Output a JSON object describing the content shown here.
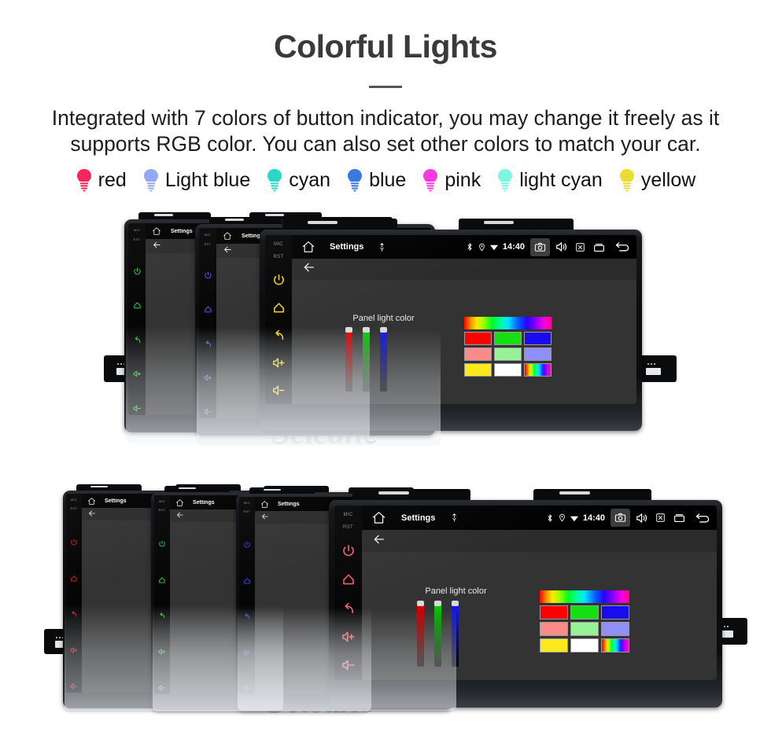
{
  "header": {
    "title": "Colorful Lights",
    "subtitle": "Integrated with 7 colors of button indicator, you may change it freely as it supports RGB color. You can also set other colors to match your car."
  },
  "legend": {
    "items": [
      {
        "label": "red",
        "color": "#f5265e",
        "icon": "bulb-icon"
      },
      {
        "label": "Light blue",
        "color": "#94a8f5",
        "icon": "bulb-icon"
      },
      {
        "label": "cyan",
        "color": "#2ad7c8",
        "icon": "bulb-icon"
      },
      {
        "label": "blue",
        "color": "#3a7ae0",
        "icon": "bulb-icon"
      },
      {
        "label": "pink",
        "color": "#f83ae0",
        "icon": "bulb-icon"
      },
      {
        "label": "light cyan",
        "color": "#7df5e0",
        "icon": "bulb-icon"
      },
      {
        "label": "yellow",
        "color": "#ebdb32",
        "icon": "bulb-icon"
      }
    ]
  },
  "device": {
    "status_bar": {
      "title": "Settings",
      "clock": "14:40",
      "icons": [
        "home-icon",
        "mic-icon",
        "bluetooth-icon",
        "location-icon",
        "wifi-icon",
        "camera-icon",
        "volume-icon",
        "close-box-icon",
        "recents-icon",
        "back-icon"
      ]
    },
    "side_keys": {
      "mic_label": "MIC",
      "rst_label": "RST",
      "keys": [
        "power-icon",
        "home-icon",
        "back-icon",
        "volume-up-icon",
        "volume-down-icon"
      ]
    },
    "screen": {
      "back_arrow": "back-arrow-icon",
      "panel_label": "Panel light color",
      "sliders": [
        {
          "name": "red-slider",
          "color": "#ee0000",
          "value": 96
        },
        {
          "name": "green-slider",
          "color": "#00dd00",
          "value": 96
        },
        {
          "name": "blue-slider",
          "color": "#1a1aff",
          "value": 96
        }
      ],
      "rainbow_bar": "rainbow-gradient",
      "swatches": [
        [
          "#ff0000",
          "#14e014",
          "#1a0aee"
        ],
        [
          "#fb8b8b",
          "#97f297",
          "#8f8ff7"
        ],
        [
          "#fbe91b",
          "#ffffff",
          "rainbow"
        ]
      ]
    }
  },
  "groups": [
    {
      "name": "top-group",
      "units": [
        {
          "key_color": "#2ecc40",
          "label": "green-unit"
        },
        {
          "key_color": "#6a4ef0",
          "label": "purple-unit"
        },
        {
          "key_color": "#f2d01a",
          "label": "yellow-unit"
        }
      ]
    },
    {
      "name": "bottom-group",
      "units": [
        {
          "key_color": "#e01b24",
          "label": "red-unit"
        },
        {
          "key_color": "#2ecc40",
          "label": "green-unit"
        },
        {
          "key_color": "#2b4ef5",
          "label": "blue-unit"
        },
        {
          "key_color": "#f25a6e",
          "label": "pink-unit"
        }
      ]
    }
  ],
  "watermark": {
    "text": "Seicane"
  }
}
